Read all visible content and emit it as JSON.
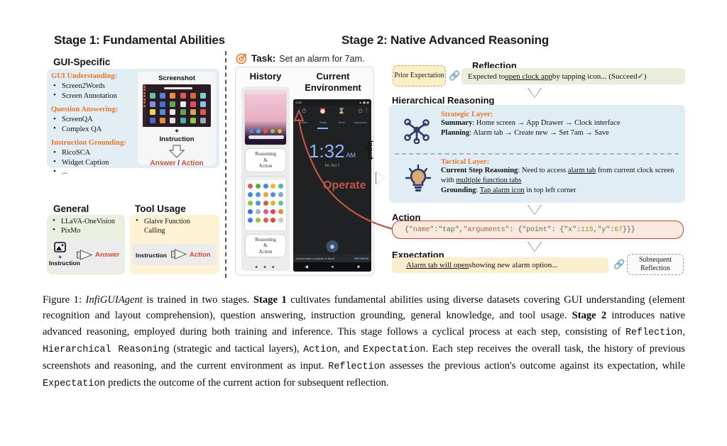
{
  "stage1": {
    "title": "Stage 1: Fundamental Abilities",
    "gui_specific": {
      "heading": "GUI-Specific",
      "categories": [
        {
          "label": "GUI Understanding:",
          "items": [
            "Screen2Words",
            "Screen Annotation"
          ]
        },
        {
          "label": "Question Answering:",
          "items": [
            "ScreenQA",
            "Complex QA"
          ]
        },
        {
          "label": "Instruction Grounding:",
          "items": [
            "RicoSCA",
            "Widget Caption",
            "..."
          ]
        }
      ],
      "card": {
        "screenshot_label": "Screenshot",
        "plus": "+",
        "instruction_label": "Instruction",
        "output_answer": "Answer",
        "output_slash": " / ",
        "output_action": "Action"
      }
    },
    "general": {
      "heading": "General",
      "items": [
        "LLaVA-OneVision",
        "PixMo"
      ],
      "plus": "+",
      "input_label": "Instruction",
      "output_label": "Answer"
    },
    "tool_usage": {
      "heading": "Tool Usage",
      "items": [
        "Glaive Function",
        "Calling"
      ],
      "input_label": "Instruction",
      "output_label": "Action"
    }
  },
  "stage2": {
    "title": "Stage 2: Native Advanced Reasoning",
    "task": {
      "icon": "target-icon",
      "label": "Task:",
      "text": "Set an alarm for 7am."
    },
    "env": {
      "history_heading": "History",
      "current_heading": "Current Environment",
      "reasoning_action_label": "Reasoning\n&\nAction",
      "ellipsis": "• • •",
      "operate_label": "Operate",
      "input_label": "Input"
    },
    "phone": {
      "status_time": "1:32",
      "tabs": [
        "Alarm",
        "Clock",
        "Timer",
        "Stopwatch"
      ],
      "active_tab": "Clock",
      "time": "1:32",
      "ampm": "AM",
      "date": "Fri, Oct 7",
      "snackbar_text": "Default alarm ringtone is silent",
      "snackbar_action": "SETTINGS"
    },
    "reflection": {
      "prior_expectation": "Prior Expectation",
      "heading": "Reflection",
      "text_pre": "Expected to ",
      "text_underlined": "open clock app",
      "text_post": " by tapping icon... (Succeed ",
      "check": "✓",
      "text_end": ")"
    },
    "hierarchical": {
      "heading": "Hierarchical Reasoning",
      "strategic": {
        "title": "Strategic Layer:",
        "summary_label": "Summary",
        "summary_text": "Home screen → App Drawer → Clock interface",
        "planning_label": "Planning",
        "planning_text": "Alarm tab → Create new → Set 7am → Save"
      },
      "tactical": {
        "title": "Tactical Layer:",
        "reasoning_label": "Current Step Reasoning",
        "reasoning_pre": "Need to access ",
        "reasoning_u1": "alarm tab",
        "reasoning_mid": " from current clock screen with ",
        "reasoning_u2": "multiple function tabs",
        "grounding_label": "Grounding",
        "grounding_u": "Tap alarm icon",
        "grounding_post": " in top left corner"
      }
    },
    "action": {
      "heading": "Action",
      "json_full": "{\"name\": \"tap\", \"arguments\": {\"point\": {\"x\": 115, \"y\": 67}}}",
      "name_key": "\"name\"",
      "name_val": "\"tap\"",
      "args_key": "\"arguments\"",
      "point_key": "\"point\"",
      "x_key": "\"x\"",
      "x_val": "115",
      "y_key": "\"y\"",
      "y_val": "67"
    },
    "expectation": {
      "heading": "Expectation",
      "underlined": "Alarm tab will open",
      "rest": " showing new alarm option...",
      "subsequent": "Subsequent Reflection"
    }
  },
  "caption": {
    "figure_label": "Figure 1:",
    "model_name": "InfiGUIAgent",
    "s1": " is trained in two stages. ",
    "stage1_bold": "Stage 1",
    "s2": " cultivates fundamental abilities using diverse datasets covering GUI understanding (element recognition and layout comprehension), question answering, instruction grounding, general knowledge, and tool usage. ",
    "stage2_bold": "Stage 2",
    "s3": " introduces native advanced reasoning, employed during both training and inference. This stage follows a cyclical process at each step, consisting of ",
    "mono_reflection": "Reflection",
    "s4": ", ",
    "mono_hier": "Hierarchical Reasoning",
    "s5": " (strategic and tactical layers), ",
    "mono_action": "Action",
    "s6": ", and ",
    "mono_expect": "Expectation",
    "s7": ". Each step receives the overall task, the history of previous screenshots and reasoning, and the current environment as input. ",
    "mono_reflection2": "Reflection",
    "s8": " assesses the previous action's outcome against its expectation, while ",
    "mono_expect2": "Expectation",
    "s9": " predicts the outcome of the current action for subsequent reflection."
  },
  "colors": {
    "orange": "#e8762c",
    "blue_box": "#e0edf4",
    "yellow_box": "#fbeecd",
    "green_box": "#eaeedd",
    "action_border": "#b5453c",
    "accent_red": "#c0554a",
    "navy": "#2f3a6b"
  }
}
